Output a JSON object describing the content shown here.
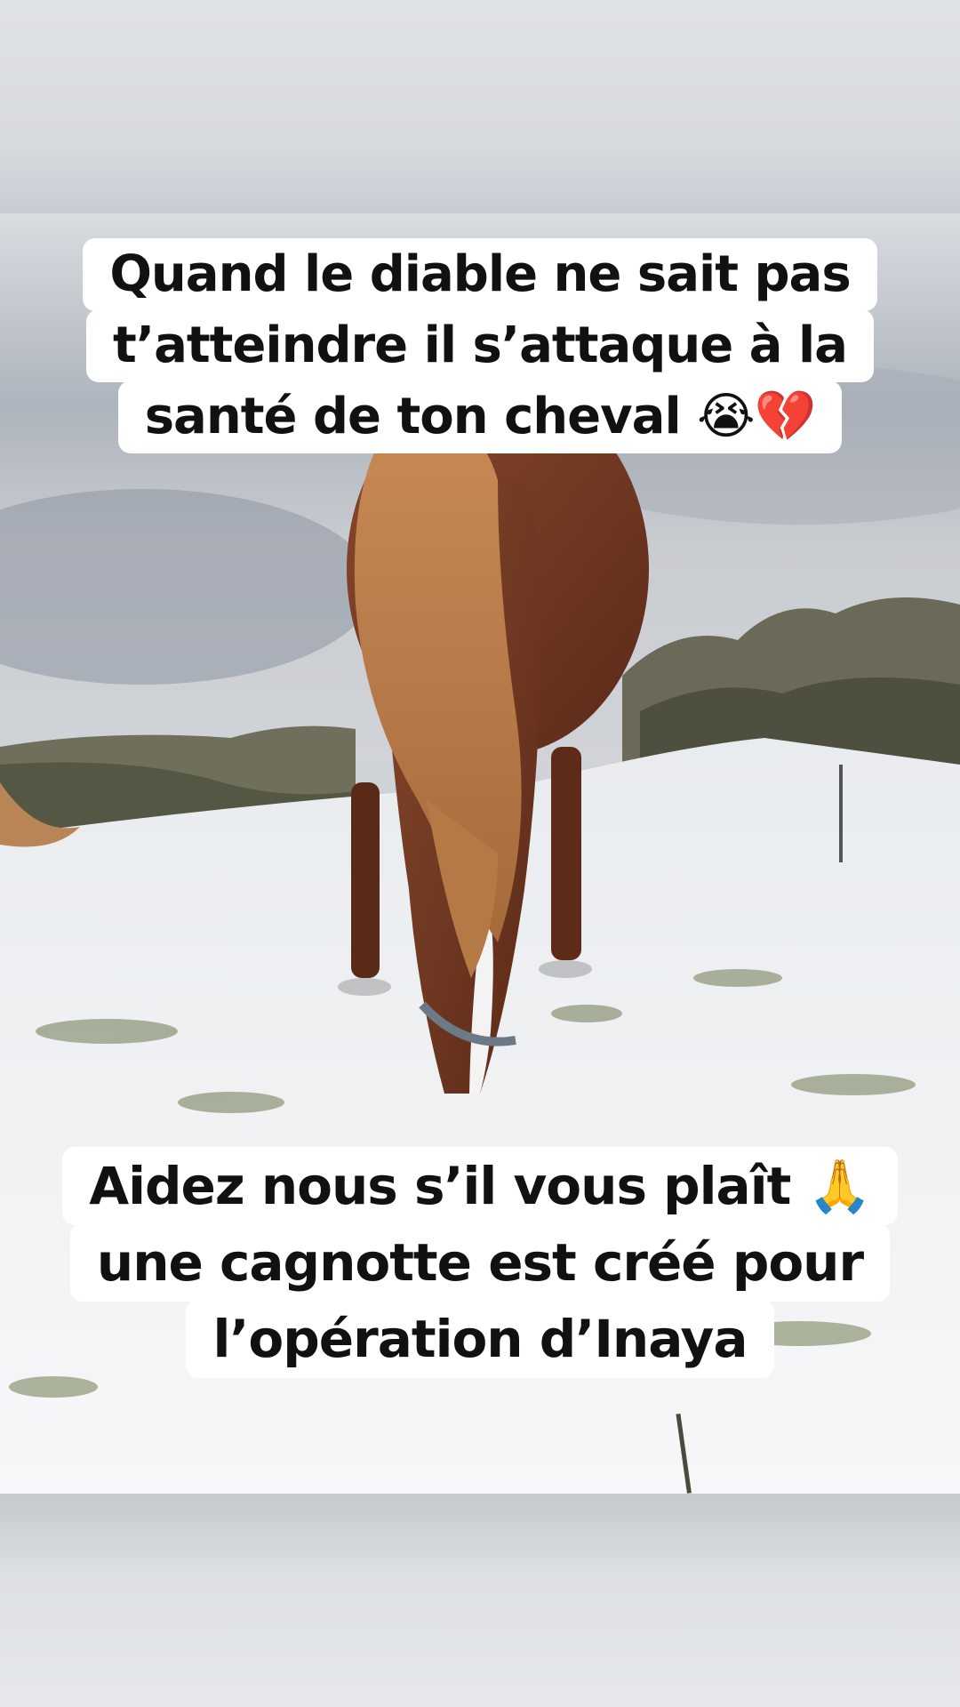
{
  "video": {
    "caption_top": {
      "lines": [
        "Quand le diable ne sait pas",
        "t’atteindre il s’attaque à la",
        "santé de ton cheval 😭💔"
      ]
    },
    "caption_bottom": {
      "lines": [
        "Aidez nous s’il vous plaît 🙏",
        "une cagnotte est créé pour",
        "l’opération d’Inaya"
      ]
    },
    "scene_icon": "horse-in-snow-photo"
  }
}
